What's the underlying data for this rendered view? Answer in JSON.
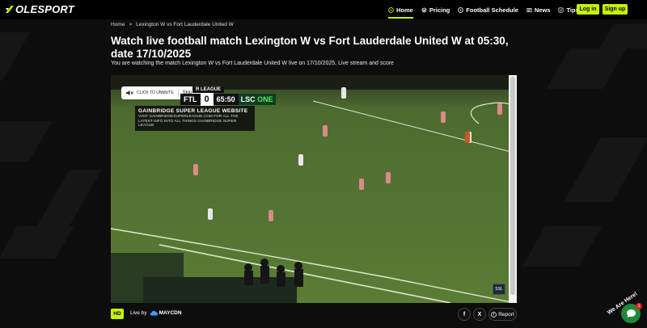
{
  "brand": {
    "logo_text": "OLESPORT",
    "accent": "#c6f400"
  },
  "nav": {
    "items": [
      {
        "label": "Home",
        "icon": "soccer-ball-icon",
        "active": true
      },
      {
        "label": "Pricing",
        "icon": "layers-icon",
        "active": false
      },
      {
        "label": "Football Schedule",
        "icon": "soccer-ball-icon",
        "active": false
      },
      {
        "label": "News",
        "icon": "newspaper-icon",
        "active": false
      },
      {
        "label": "Tips",
        "icon": "tips-icon",
        "active": false
      }
    ],
    "login_label": "Log in",
    "signup_label": "Sign up"
  },
  "breadcrumb": {
    "home": "Home",
    "separator": ">",
    "current": "Lexington W vs Fort Lauderdale United W"
  },
  "page": {
    "title": "Watch live football match Lexington W vs Fort Lauderdale United W at 05:30, date 17/10/2025",
    "subtitle": "You are watching the match Lexington W vs Fort Lauderdale United W live on 17/10/2025, Live stream and score"
  },
  "player": {
    "unmute_label": "CLICK TO UNMUTE",
    "skip_label": "Skip",
    "league_strip": "R LEAGUE",
    "score_team": "FTL",
    "score_value": "0",
    "clock": "65:50",
    "brand_left": "LSC",
    "brand_right": "ONE",
    "promo_title": "GAINBRIDGE SUPER LEAGUE WEBSITE",
    "promo_text": "VISIT GAINBRIDGESUPERLEAGUE.COM FOR ALL THE LATEST INFO INTO ALL THINGS GAINBRIDGE SUPER LEAGUE",
    "corner_logo": "SSL"
  },
  "footer_bar": {
    "quality_badge": "HD",
    "live_by_label": "Live by",
    "cdn_name": "MAYCDN",
    "facebook_label": "f",
    "twitter_label": "X",
    "report_label": "Report"
  },
  "chat": {
    "label": "We Are Here!",
    "badge_count": "1"
  }
}
